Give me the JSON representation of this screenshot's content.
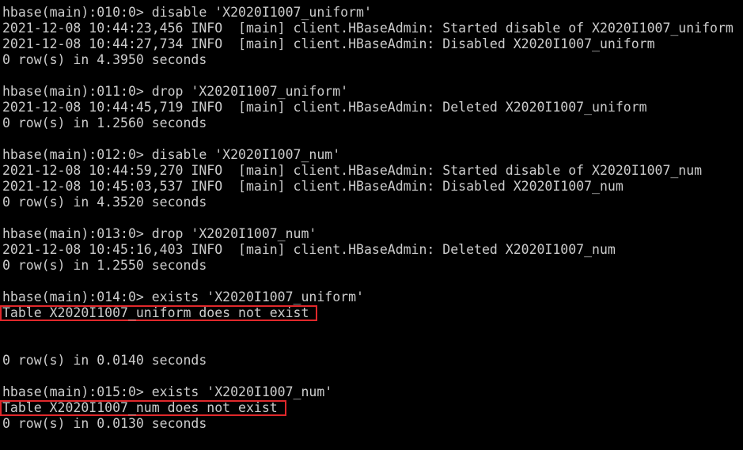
{
  "terminal": {
    "lines": [
      "hbase(main):010:0> disable 'X2020I1007_uniform'",
      "2021-12-08 10:44:23,456 INFO  [main] client.HBaseAdmin: Started disable of X2020I1007_uniform",
      "2021-12-08 10:44:27,734 INFO  [main] client.HBaseAdmin: Disabled X2020I1007_uniform",
      "0 row(s) in 4.3950 seconds",
      "",
      "hbase(main):011:0> drop 'X2020I1007_uniform'",
      "2021-12-08 10:44:45,719 INFO  [main] client.HBaseAdmin: Deleted X2020I1007_uniform",
      "0 row(s) in 1.2560 seconds",
      "",
      "hbase(main):012:0> disable 'X2020I1007_num'",
      "2021-12-08 10:44:59,270 INFO  [main] client.HBaseAdmin: Started disable of X2020I1007_num",
      "2021-12-08 10:45:03,537 INFO  [main] client.HBaseAdmin: Disabled X2020I1007_num",
      "0 row(s) in 4.3520 seconds",
      "",
      "hbase(main):013:0> drop 'X2020I1007_num'",
      "2021-12-08 10:45:16,403 INFO  [main] client.HBaseAdmin: Deleted X2020I1007_num",
      "0 row(s) in 1.2550 seconds",
      "",
      "hbase(main):014:0> exists 'X2020I1007_uniform'",
      "Table X2020I1007_uniform does not exist",
      "",
      "",
      "0 row(s) in 0.0140 seconds",
      "",
      "hbase(main):015:0> exists 'X2020I1007_num'",
      "Table X2020I1007_num does not exist",
      "0 row(s) in 0.0130 seconds"
    ]
  },
  "colors": {
    "background": "#000000",
    "text": "#cccccc",
    "highlight_border": "#e0282b"
  }
}
